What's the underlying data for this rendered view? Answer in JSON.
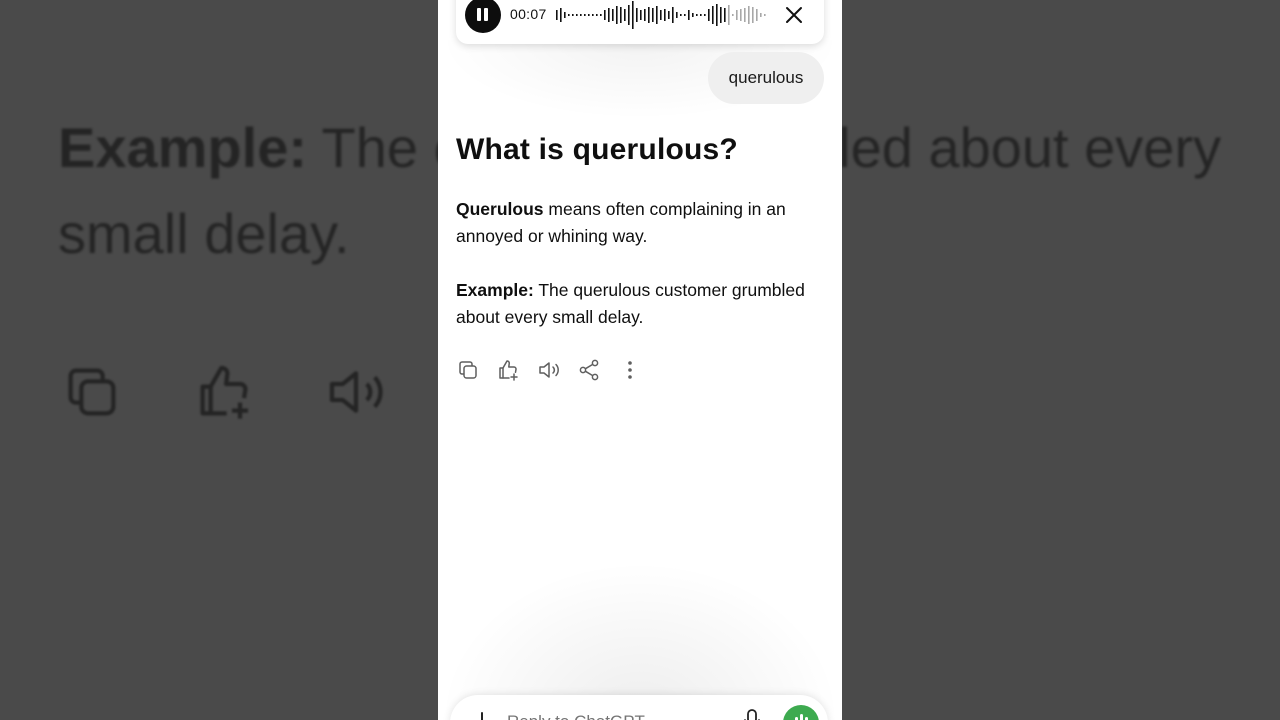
{
  "background": {
    "example_label": "Example:",
    "example_text": " The customer grumbled about every small delay."
  },
  "audio_player": {
    "timestamp": "00:07",
    "pause_icon": "pause-icon",
    "close_icon": "close-icon"
  },
  "user_message": "querulous",
  "assistant": {
    "heading": "What is querulous?",
    "definition_term": "Querulous",
    "definition_text": " means often complaining in an annoyed or whining way.",
    "example_label": "Example:",
    "example_text": " The querulous customer grumbled about every small delay."
  },
  "actions": [
    "copy-icon",
    "thumbs-up-icon",
    "speaker-icon",
    "share-icon",
    "more-icon"
  ],
  "composer": {
    "placeholder": "Reply to ChatGPT"
  },
  "colors": {
    "accent_green": "#3daa4f",
    "background_dim": "#4a4a4a"
  }
}
